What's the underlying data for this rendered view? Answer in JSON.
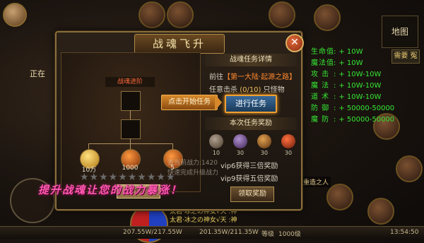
{
  "background": {
    "top_left_label": "正在",
    "map_button": "地图",
    "mail_button": "需要 冤",
    "boss_tag": "重造之人"
  },
  "dialog": {
    "title": "战魂飞升",
    "close_glyph": "✕",
    "stage_label": "战魂进阶",
    "items": [
      {
        "qty": "10万",
        "icon": "gold-ingot-icon"
      },
      {
        "qty": "1000",
        "icon": "orb-icon"
      },
      {
        "qty": "5",
        "icon": "orb-icon"
      }
    ],
    "stars": "★★★★★★★★★★",
    "upgrade_button": "提升境界",
    "start_quest_button": "点击开始任务",
    "ghost_text_1": "查当前战力:1420",
    "ghost_text_2": "快速完成升级战力",
    "banner": "提升战魂让您的战力暴涨！"
  },
  "quest_panel": {
    "details_header": "战魂任务详情",
    "go_to_prefix": "前往",
    "go_to_location": "【第一大陆·起源之路】",
    "task_prefix": "任意击杀",
    "task_progress": "(0/10)",
    "task_suffix": "只怪物",
    "go_button": "进行任务",
    "reward_header": "本次任务奖励",
    "rewards": [
      {
        "qty": "10",
        "color": "#7a6a58"
      },
      {
        "qty": "30",
        "color": "#6a4a8a"
      },
      {
        "qty": "30",
        "color": "#8a6030"
      },
      {
        "qty": "30",
        "color": "#c04a20"
      }
    ],
    "vip6": "vip6获得三倍奖励",
    "vip9": "vip9获得五倍奖励",
    "claim_button": "领取奖励"
  },
  "stats": [
    {
      "label": "生命值",
      "value": "+ 10W"
    },
    {
      "label": "魔法值",
      "value": "+ 10W"
    },
    {
      "label": "攻  击",
      "value": "+ 10W-10W"
    },
    {
      "label": "魔  法",
      "value": "+ 10W-10W"
    },
    {
      "label": "道  术",
      "value": "+ 10W-10W"
    },
    {
      "label": "防  御",
      "value": "+ 50000-50000"
    },
    {
      "label": "魔  防",
      "value": "+ 50000-50000"
    }
  ],
  "chat": {
    "line1": "太君·冰之の神女√天 :神",
    "line2": "太君·冰之の神女√天 :神"
  },
  "hud": {
    "hp": "207.55W/217.55W",
    "mp": "201.35W/211.35W",
    "level_label": "等级",
    "level": "1000级",
    "time": "13:54:50"
  }
}
